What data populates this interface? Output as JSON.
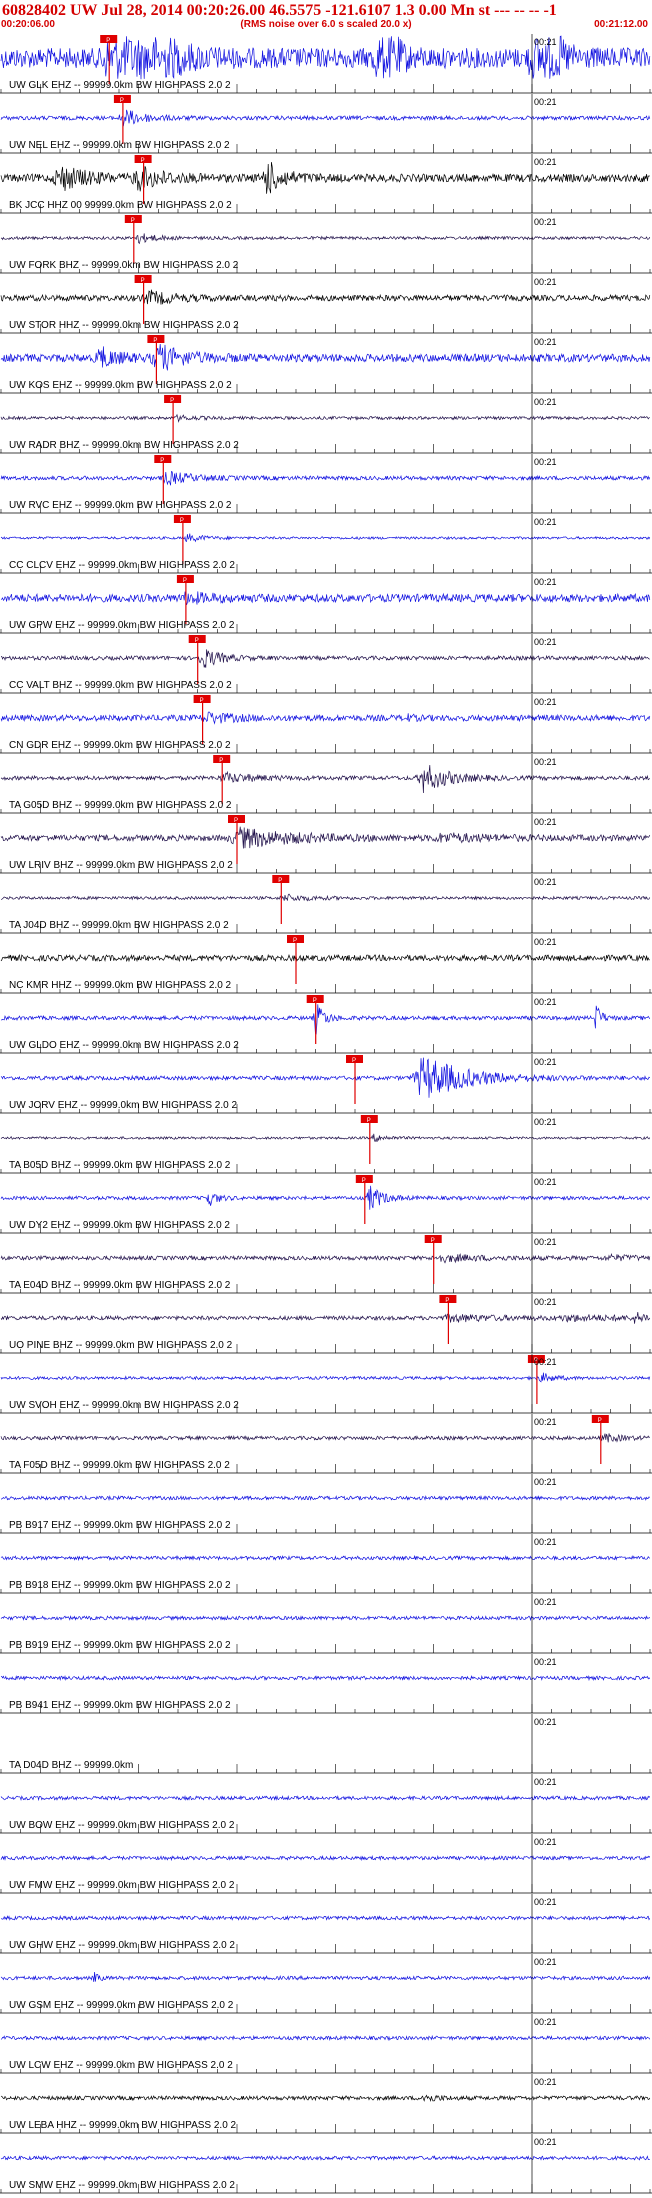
{
  "header": {
    "title": "60828402 UW Jul 28, 2014 00:20:26.00   46.5575 -121.6107  1.3 0.00 Mn st --- -- --   -1",
    "start_time": "00:20:06.00",
    "noise_note": "(RMS noise over 6.0 s scaled 20.0 x)",
    "end_time": "00:21:12.00"
  },
  "colors": {
    "blue": "#1010e0",
    "navy": "#20104a",
    "black": "#000000",
    "pick": "#e00000",
    "text": "#000000",
    "title": "#d40000"
  },
  "chart_data": {
    "type": "line",
    "title": "60828402 UW Jul 28, 2014 00:20:26.00   46.5575 -121.6107  1.3 0.00 Mn st --- -- --   -1",
    "x_range_seconds": [
      0,
      66
    ],
    "x_start_label": "00:20:06.00",
    "x_end_label": "00:21:12.00",
    "minute_label": "00:21",
    "minute_mark_seconds": 54,
    "tick_interval_seconds": 2,
    "pick_label": "P",
    "grid": false,
    "series": [
      {
        "name": "UW GLK EHZ -- 99999.0km BW  HIGHPASS  2.0  2",
        "color": "blue",
        "amp": 10,
        "pick": 11.0,
        "bursts": [
          [
            11,
            3,
            16,
            2
          ],
          [
            38,
            1.2,
            14,
            1
          ],
          [
            54,
            1.5,
            14,
            2
          ]
        ]
      },
      {
        "name": "UW NEL EHZ -- 99999.0km BW  HIGHPASS  2.0  2",
        "color": "blue",
        "amp": 2,
        "pick": 12.4,
        "bursts": [
          [
            12.5,
            2.5,
            5,
            3
          ]
        ]
      },
      {
        "name": "BK JCC HHZ 00 99999.0km BW  HIGHPASS  2.0  2",
        "color": "black",
        "amp": 4,
        "pick": 14.5,
        "bursts": [
          [
            6,
            3,
            4,
            2
          ],
          [
            14,
            3,
            3.5,
            2
          ],
          [
            27,
            2,
            5,
            2
          ]
        ]
      },
      {
        "name": "UW FORK BHZ -- 99999.0km BW  HIGHPASS  2.0  2",
        "color": "navy",
        "amp": 1.5,
        "pick": 13.5,
        "bursts": [
          [
            14,
            2,
            4,
            2
          ]
        ]
      },
      {
        "name": "UW STOR HHZ -- 99999.0km BW  HIGHPASS  2.0  2",
        "color": "black",
        "amp": 3,
        "pick": 14.5,
        "bursts": [
          [
            15,
            3,
            3,
            2
          ]
        ]
      },
      {
        "name": "UW KOS EHZ -- 99999.0km BW  HIGHPASS  2.0  2",
        "color": "blue",
        "amp": 4,
        "pick": 15.8,
        "bursts": [
          [
            10,
            2,
            3.5,
            2
          ],
          [
            16,
            3,
            4,
            2
          ]
        ]
      },
      {
        "name": "UW RADR BHZ -- 99999.0km BW  HIGHPASS  2.0  2",
        "color": "navy",
        "amp": 1.5,
        "pick": 17.5,
        "bursts": [
          [
            18,
            2,
            2.5,
            3
          ]
        ]
      },
      {
        "name": "UW RVC EHZ -- 99999.0km BW  HIGHPASS  2.0  2",
        "color": "blue",
        "amp": 2,
        "pick": 16.5,
        "bursts": [
          [
            17,
            3,
            4,
            3
          ]
        ]
      },
      {
        "name": "CC CLCV EHZ -- 99999.0km BW  HIGHPASS  2.0  2",
        "color": "blue",
        "amp": 1.2,
        "pick": 18.5,
        "bursts": [
          [
            19,
            2,
            4,
            3
          ]
        ]
      },
      {
        "name": "UW GPW EHZ -- 99999.0km BW  HIGHPASS  2.0  2",
        "color": "blue",
        "amp": 4,
        "pick": 18.8,
        "bursts": [
          [
            19,
            3,
            2,
            2
          ]
        ]
      },
      {
        "name": "CC VALT BHZ -- 99999.0km BW  HIGHPASS  2.0  2",
        "color": "navy",
        "amp": 2,
        "pick": 20.0,
        "bursts": [
          [
            20.5,
            2,
            6,
            3
          ]
        ]
      },
      {
        "name": "CN GDR EHZ -- 99999.0km BW  HIGHPASS  2.0  2",
        "color": "blue",
        "amp": 3,
        "pick": 20.5,
        "bursts": [
          [
            21,
            3,
            2.5,
            3
          ],
          [
            41,
            1,
            2,
            1
          ]
        ]
      },
      {
        "name": "TA G05D BHZ -- 99999.0km BW  HIGHPASS  2.0  2",
        "color": "navy",
        "amp": 2,
        "pick": 22.5,
        "bursts": [
          [
            23,
            4,
            3,
            3
          ],
          [
            43,
            3,
            8,
            2
          ]
        ]
      },
      {
        "name": "UW LRIV BHZ -- 99999.0km BW  HIGHPASS  2.0  2",
        "color": "navy",
        "amp": 3,
        "pick": 24.0,
        "bursts": [
          [
            24.5,
            6,
            4,
            3
          ],
          [
            45,
            6,
            2,
            2
          ]
        ]
      },
      {
        "name": "TA J04D BHZ -- 99999.0km BW  HIGHPASS  2.0  2",
        "color": "navy",
        "amp": 1.5,
        "pick": 28.5,
        "bursts": [
          [
            29,
            3,
            3,
            3
          ]
        ]
      },
      {
        "name": "NC KMR HHZ -- 99999.0km BW  HIGHPASS  2.0  2",
        "color": "black",
        "amp": 3,
        "pick": 30.0,
        "bursts": []
      },
      {
        "name": "UW GLDO EHZ -- 99999.0km BW  HIGHPASS  2.0  2",
        "color": "blue",
        "amp": 2,
        "pick": 32.0,
        "bursts": [
          [
            32,
            1,
            9,
            3
          ],
          [
            60.5,
            0.6,
            9,
            1
          ]
        ]
      },
      {
        "name": "UW JORV EHZ -- 99999.0km BW  HIGHPASS  2.0  2",
        "color": "blue",
        "amp": 2,
        "pick": 36.0,
        "bursts": [
          [
            43,
            5,
            12,
            1
          ]
        ]
      },
      {
        "name": "TA B05D BHZ -- 99999.0km BW  HIGHPASS  2.0  2",
        "color": "navy",
        "amp": 1.2,
        "pick": 37.5,
        "bursts": [
          [
            38,
            1.5,
            4,
            3
          ]
        ]
      },
      {
        "name": "UW DY2 EHZ -- 99999.0km BW  HIGHPASS  2.0  2",
        "color": "blue",
        "amp": 1.8,
        "pick": 37.0,
        "bursts": [
          [
            21,
            1,
            6,
            2
          ],
          [
            37.5,
            1.5,
            8,
            2
          ]
        ]
      },
      {
        "name": "TA E04D BHZ -- 99999.0km BW  HIGHPASS  2.0  2",
        "color": "navy",
        "amp": 2,
        "pick": 44.0,
        "bursts": [
          [
            45,
            5,
            2.5,
            2
          ],
          [
            62,
            4,
            2,
            2
          ]
        ]
      },
      {
        "name": "UO PINE BHZ -- 99999.0km BW  HIGHPASS  2.0  2",
        "color": "navy",
        "amp": 2,
        "pick": 45.5,
        "bursts": [
          [
            46,
            6,
            2.5,
            2
          ],
          [
            58,
            8,
            2,
            2
          ],
          [
            64.5,
            1.5,
            3,
            2
          ]
        ]
      },
      {
        "name": "UW SVOH EHZ -- 99999.0km BW  HIGHPASS  2.0  2",
        "color": "blue",
        "amp": 1.5,
        "pick": 54.5,
        "bursts": [
          [
            55,
            1.5,
            4,
            2
          ]
        ]
      },
      {
        "name": "TA F05D BHZ -- 99999.0km BW  HIGHPASS  2.0  2",
        "color": "navy",
        "amp": 1.8,
        "pick": 61.0,
        "bursts": [
          [
            61.5,
            2,
            3,
            2
          ]
        ]
      },
      {
        "name": "PB B917 EHZ -- 99999.0km BW  HIGHPASS  2.0  2",
        "color": "blue",
        "amp": 1.8,
        "pick": null,
        "bursts": []
      },
      {
        "name": "PB B918 EHZ -- 99999.0km BW  HIGHPASS  2.0  2",
        "color": "blue",
        "amp": 1.8,
        "pick": null,
        "bursts": []
      },
      {
        "name": "PB B919 EHZ -- 99999.0km BW  HIGHPASS  2.0  2",
        "color": "blue",
        "amp": 1.8,
        "pick": null,
        "bursts": []
      },
      {
        "name": "PB B941 EHZ -- 99999.0km BW  HIGHPASS  2.0  2",
        "color": "blue",
        "amp": 1.8,
        "pick": null,
        "bursts": []
      },
      {
        "name": "TA D04D BHZ -- 99999.0km",
        "color": "blue",
        "amp": 0,
        "pick": null,
        "bursts": []
      },
      {
        "name": "UW BOW EHZ -- 99999.0km BW  HIGHPASS  2.0  2",
        "color": "blue",
        "amp": 1.8,
        "pick": null,
        "bursts": []
      },
      {
        "name": "UW FMW EHZ -- 99999.0km BW  HIGHPASS  2.0  2",
        "color": "blue",
        "amp": 1.8,
        "pick": null,
        "bursts": []
      },
      {
        "name": "UW GHW EHZ -- 99999.0km BW  HIGHPASS  2.0  2",
        "color": "blue",
        "amp": 1.8,
        "pick": null,
        "bursts": []
      },
      {
        "name": "UW GSM EHZ -- 99999.0km BW  HIGHPASS  2.0  2",
        "color": "blue",
        "amp": 1.8,
        "pick": null,
        "bursts": [
          [
            9.5,
            0.5,
            4,
            1
          ]
        ]
      },
      {
        "name": "UW LCW EHZ -- 99999.0km BW  HIGHPASS  2.0  2",
        "color": "blue",
        "amp": 1.8,
        "pick": null,
        "bursts": []
      },
      {
        "name": "UW LEBA HHZ -- 99999.0km BW  HIGHPASS  2.0  2",
        "color": "black",
        "amp": 2,
        "pick": null,
        "bursts": [
          [
            43,
            1.5,
            3,
            2
          ]
        ]
      },
      {
        "name": "UW SMW EHZ -- 99999.0km BW  HIGHPASS  2.0  2",
        "color": "blue",
        "amp": 1.8,
        "pick": null,
        "bursts": []
      }
    ]
  }
}
